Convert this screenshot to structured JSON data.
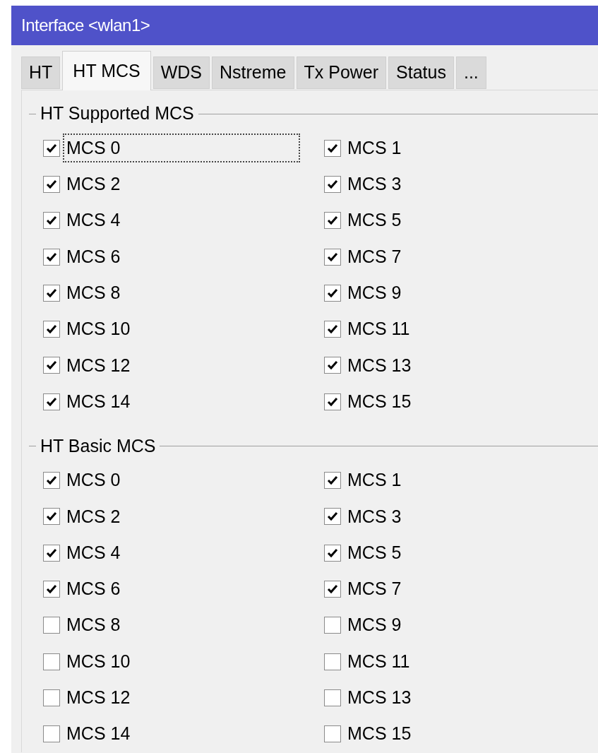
{
  "window": {
    "title": "Interface <wlan1>"
  },
  "tabs": [
    {
      "label": "HT",
      "selected": false
    },
    {
      "label": "HT MCS",
      "selected": true
    },
    {
      "label": "WDS",
      "selected": false
    },
    {
      "label": "Nstreme",
      "selected": false
    },
    {
      "label": "Tx Power",
      "selected": false
    },
    {
      "label": "Status",
      "selected": false
    },
    {
      "label": "...",
      "selected": false
    }
  ],
  "groups": [
    {
      "title": "HT Supported MCS",
      "items": [
        {
          "label": "MCS 0",
          "checked": true,
          "focused": true
        },
        {
          "label": "MCS 1",
          "checked": true,
          "focused": false
        },
        {
          "label": "MCS 2",
          "checked": true,
          "focused": false
        },
        {
          "label": "MCS 3",
          "checked": true,
          "focused": false
        },
        {
          "label": "MCS 4",
          "checked": true,
          "focused": false
        },
        {
          "label": "MCS 5",
          "checked": true,
          "focused": false
        },
        {
          "label": "MCS 6",
          "checked": true,
          "focused": false
        },
        {
          "label": "MCS 7",
          "checked": true,
          "focused": false
        },
        {
          "label": "MCS 8",
          "checked": true,
          "focused": false
        },
        {
          "label": "MCS 9",
          "checked": true,
          "focused": false
        },
        {
          "label": "MCS 10",
          "checked": true,
          "focused": false
        },
        {
          "label": "MCS 11",
          "checked": true,
          "focused": false
        },
        {
          "label": "MCS 12",
          "checked": true,
          "focused": false
        },
        {
          "label": "MCS 13",
          "checked": true,
          "focused": false
        },
        {
          "label": "MCS 14",
          "checked": true,
          "focused": false
        },
        {
          "label": "MCS 15",
          "checked": true,
          "focused": false
        }
      ]
    },
    {
      "title": "HT Basic MCS",
      "items": [
        {
          "label": "MCS 0",
          "checked": true,
          "focused": false
        },
        {
          "label": "MCS 1",
          "checked": true,
          "focused": false
        },
        {
          "label": "MCS 2",
          "checked": true,
          "focused": false
        },
        {
          "label": "MCS 3",
          "checked": true,
          "focused": false
        },
        {
          "label": "MCS 4",
          "checked": true,
          "focused": false
        },
        {
          "label": "MCS 5",
          "checked": true,
          "focused": false
        },
        {
          "label": "MCS 6",
          "checked": true,
          "focused": false
        },
        {
          "label": "MCS 7",
          "checked": true,
          "focused": false
        },
        {
          "label": "MCS 8",
          "checked": false,
          "focused": false
        },
        {
          "label": "MCS 9",
          "checked": false,
          "focused": false
        },
        {
          "label": "MCS 10",
          "checked": false,
          "focused": false
        },
        {
          "label": "MCS 11",
          "checked": false,
          "focused": false
        },
        {
          "label": "MCS 12",
          "checked": false,
          "focused": false
        },
        {
          "label": "MCS 13",
          "checked": false,
          "focused": false
        },
        {
          "label": "MCS 14",
          "checked": false,
          "focused": false
        },
        {
          "label": "MCS 15",
          "checked": false,
          "focused": false
        }
      ]
    }
  ]
}
